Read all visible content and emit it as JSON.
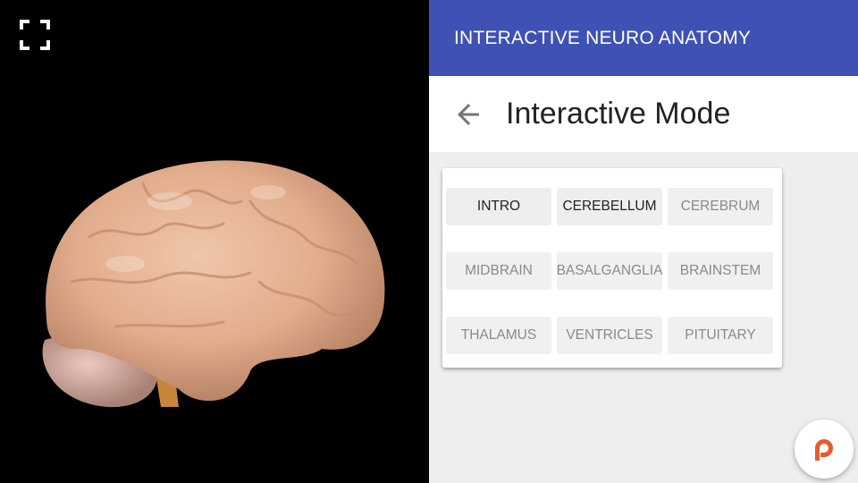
{
  "viewer": {
    "fullscreen_icon": "fullscreen-icon",
    "model": "3d-brain-model"
  },
  "header": {
    "app_title": "INTERACTIVE NEURO ANATOMY",
    "back_icon": "arrow-back-icon",
    "page_title": "Interactive Mode"
  },
  "menu": {
    "buttons": [
      {
        "label": "INTRO",
        "enabled": true
      },
      {
        "label": "CEREBELLUM",
        "enabled": true
      },
      {
        "label": "CEREBRUM",
        "enabled": false
      },
      {
        "label": "MIDBRAIN",
        "enabled": false
      },
      {
        "label": "BASALGANGLIA",
        "enabled": false
      },
      {
        "label": "BRAINSTEM",
        "enabled": false
      },
      {
        "label": "THALAMUS",
        "enabled": false
      },
      {
        "label": "VENTRICLES",
        "enabled": false
      },
      {
        "label": "PITUITARY",
        "enabled": false
      }
    ]
  },
  "fab": {
    "icon": "patreon-icon",
    "color": "#e85b2e"
  },
  "colors": {
    "appbar": "#3f51b5",
    "panel_bg": "#eeeeee"
  }
}
